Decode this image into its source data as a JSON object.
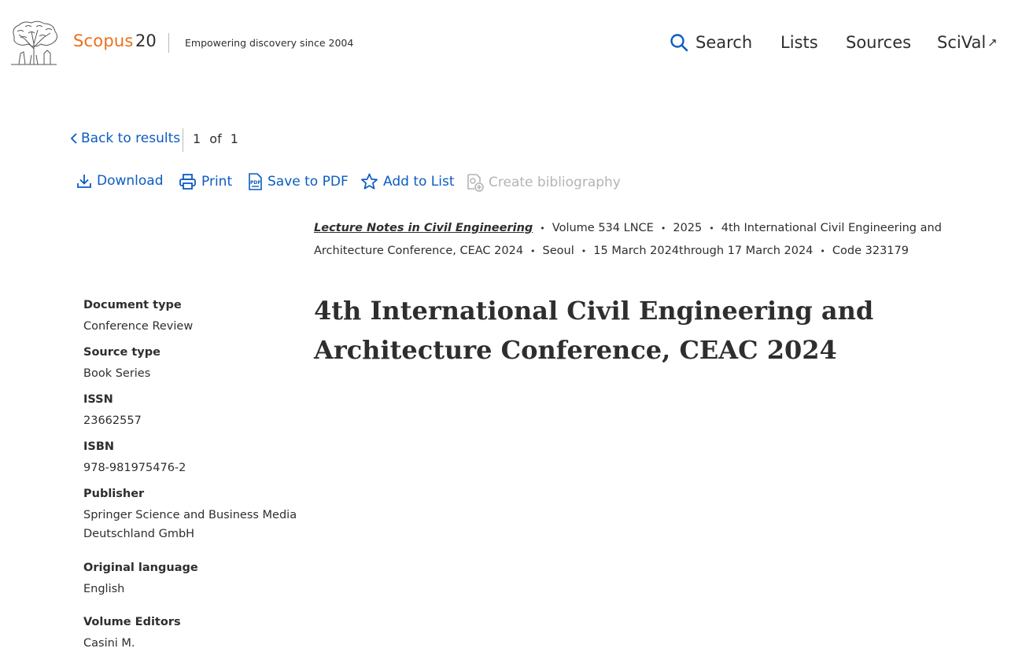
{
  "header": {
    "brand": "Scopus",
    "brand_suffix": "20",
    "tagline": "Empowering discovery since 2004",
    "nav": {
      "search": "Search",
      "lists": "Lists",
      "sources": "Sources",
      "scival": "SciVal",
      "scival_ext_icon": "↗"
    }
  },
  "results_nav": {
    "back_label": "Back to results",
    "current": "1",
    "of_label": "of",
    "total": "1"
  },
  "toolbar": {
    "download": "Download",
    "print": "Print",
    "save_pdf": "Save to PDF",
    "add_to_list": "Add to List",
    "create_bibliography": "Create bibliography"
  },
  "meta": {
    "source_title": "Lecture Notes in Civil Engineering",
    "volume": "Volume 534 LNCE",
    "year": "2025",
    "conference": "4th International Civil Engineering and Architecture Conference, CEAC 2024",
    "location": "Seoul",
    "dates": "15 March 2024through 17 March 2024",
    "code": "Code 323179",
    "separator": "•"
  },
  "document": {
    "title": "4th International Civil Engineering and Architecture Conference, CEAC 2024"
  },
  "details": {
    "document_type_label": "Document type",
    "document_type": "Conference Review",
    "source_type_label": "Source type",
    "source_type": "Book Series",
    "issn_label": "ISSN",
    "issn": "23662557",
    "isbn_label": "ISBN",
    "isbn": "978-981975476-2",
    "publisher_label": "Publisher",
    "publisher": "Springer Science and Business Media Deutschland GmbH",
    "language_label": "Original language",
    "language": "English",
    "editors_label": "Volume Editors",
    "editors": "Casini M."
  },
  "colors": {
    "brand_orange": "#e9711c",
    "link_blue": "#0b5cc2",
    "text": "#2e2e2e",
    "disabled": "#b4b4b4"
  }
}
